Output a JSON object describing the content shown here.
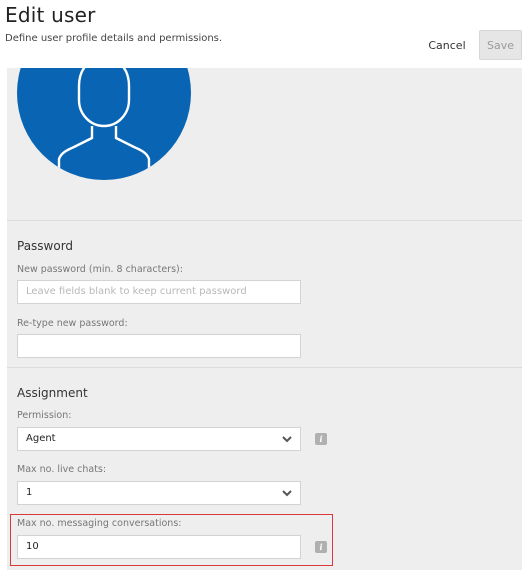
{
  "header": {
    "title": "Edit user",
    "subtitle": "Define user profile details and permissions.",
    "cancel_label": "Cancel",
    "save_label": "Save"
  },
  "password": {
    "section_title": "Password",
    "new_label": "New password (min. 8 characters):",
    "new_placeholder": "Leave fields blank to keep current password",
    "retype_label": "Re-type new password:"
  },
  "assignment": {
    "section_title": "Assignment",
    "permission_label": "Permission:",
    "permission_value": "Agent",
    "max_live_chats_label": "Max no. live chats:",
    "max_live_chats_value": "1",
    "max_messaging_label": "Max no. messaging conversations:",
    "max_messaging_value": "10"
  },
  "icons": {
    "info": "i"
  },
  "colors": {
    "avatar_bg": "#0a64b4",
    "highlight_border": "#d63a3a",
    "panel_bg": "#eeeeee"
  }
}
